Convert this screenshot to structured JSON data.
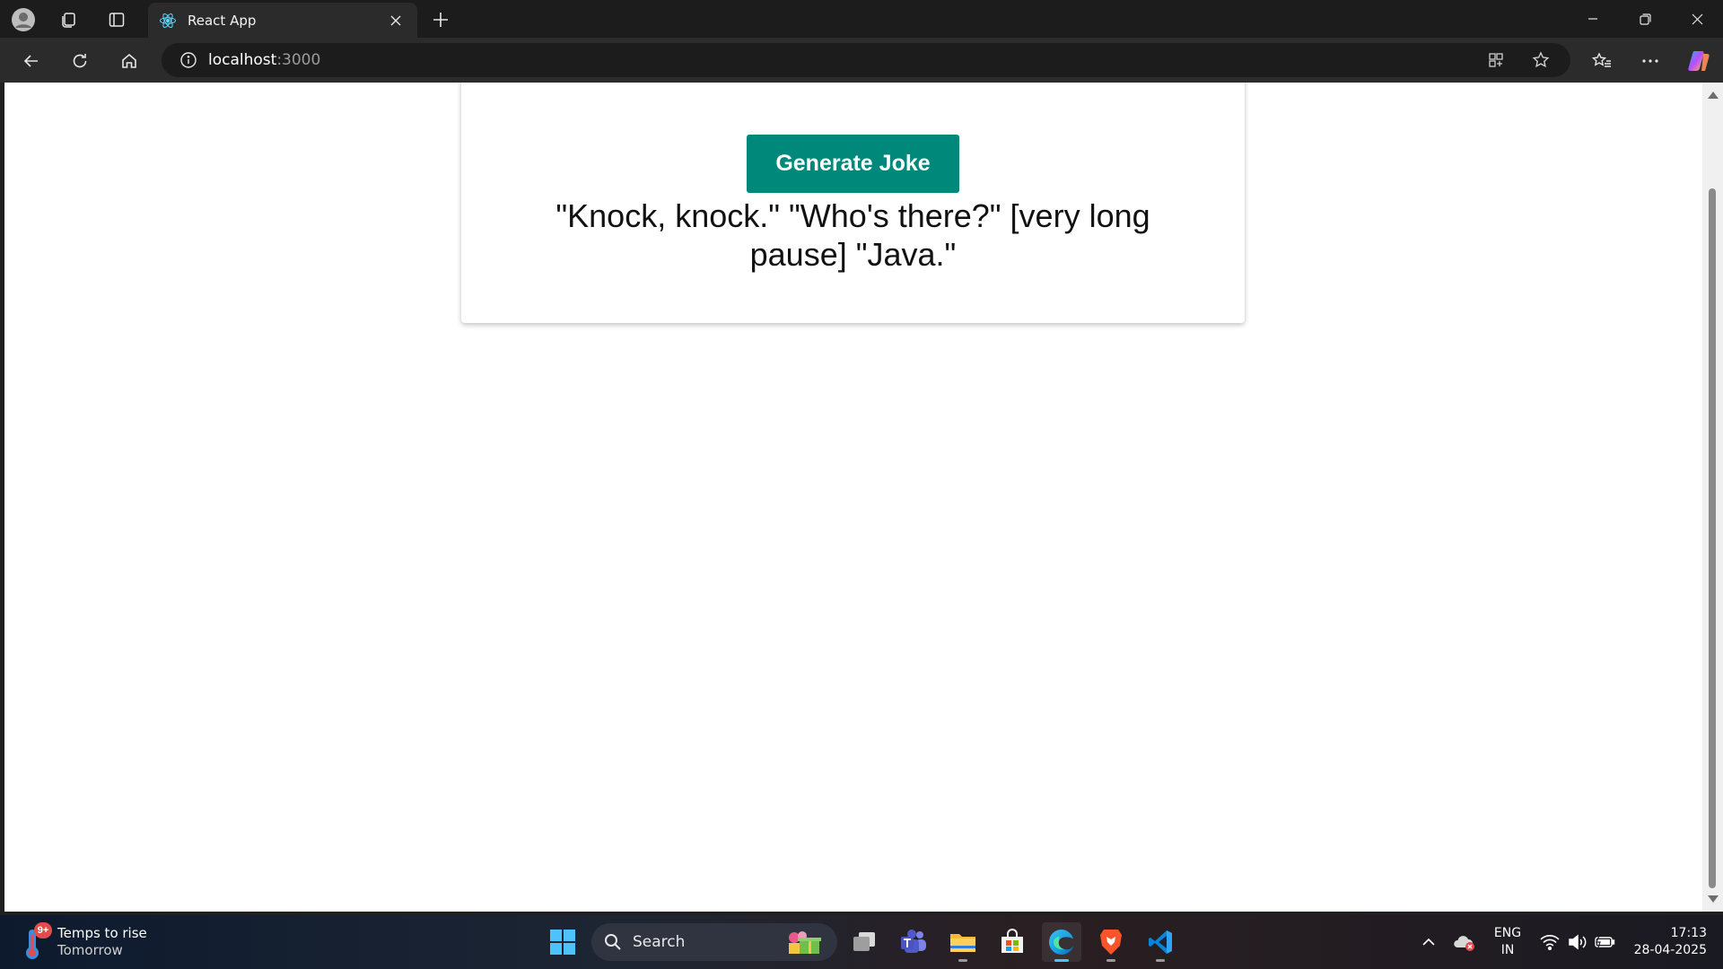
{
  "browser": {
    "tab_title": "React App",
    "url_host": "localhost",
    "url_port": ":3000"
  },
  "page": {
    "button_label": "Generate Joke",
    "joke_text": "\"Knock, knock.\" \"Who's there?\" [very long pause] \"Java.\"",
    "accent_color": "#00897b"
  },
  "taskbar": {
    "weather_title": "Temps to rise",
    "weather_subtitle": "Tomorrow",
    "weather_badge": "9+",
    "search_label": "Search",
    "lang_primary": "ENG",
    "lang_secondary": "IN",
    "time": "17:13",
    "date": "28-04-2025"
  }
}
